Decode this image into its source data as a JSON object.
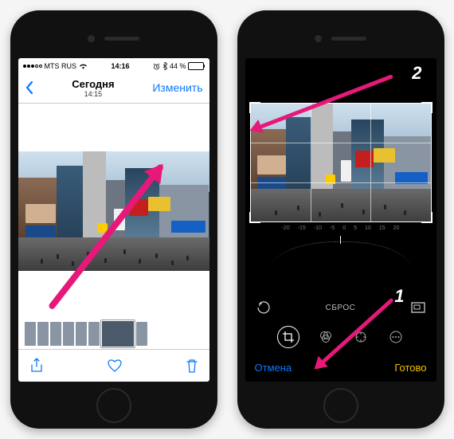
{
  "status": {
    "carrier": "MTS RUS",
    "wifi_icon": "wifi-icon",
    "time": "14:16",
    "alarm_icon": "alarm-icon",
    "bt_icon": "bluetooth-icon",
    "battery_pct_label": "44 %",
    "battery_pct": 44
  },
  "nav": {
    "back_icon": "chevron-left-icon",
    "title": "Сегодня",
    "subtitle": "14:15",
    "edit_label": "Изменить"
  },
  "thumbs": {
    "count_before": 6,
    "count_after": 1
  },
  "toolbar": {
    "share_icon": "share-icon",
    "like_icon": "heart-icon",
    "trash_icon": "trash-icon"
  },
  "editor": {
    "dial_labels": [
      "-20",
      "-15",
      "-10",
      "-5",
      "0",
      "5",
      "10",
      "15",
      "20"
    ],
    "rotate_icon": "rotate-ccw-icon",
    "aspect_icon": "aspect-ratio-icon",
    "reset_label": "СБРОС",
    "modes": {
      "crop_icon": "crop-rotate-icon",
      "filters_icon": "filters-icon",
      "adjust_icon": "adjust-dial-icon",
      "more_icon": "more-icon"
    },
    "cancel_label": "Отмена",
    "done_label": "Готово"
  },
  "annotations": {
    "label1": "1",
    "label2": "2"
  }
}
